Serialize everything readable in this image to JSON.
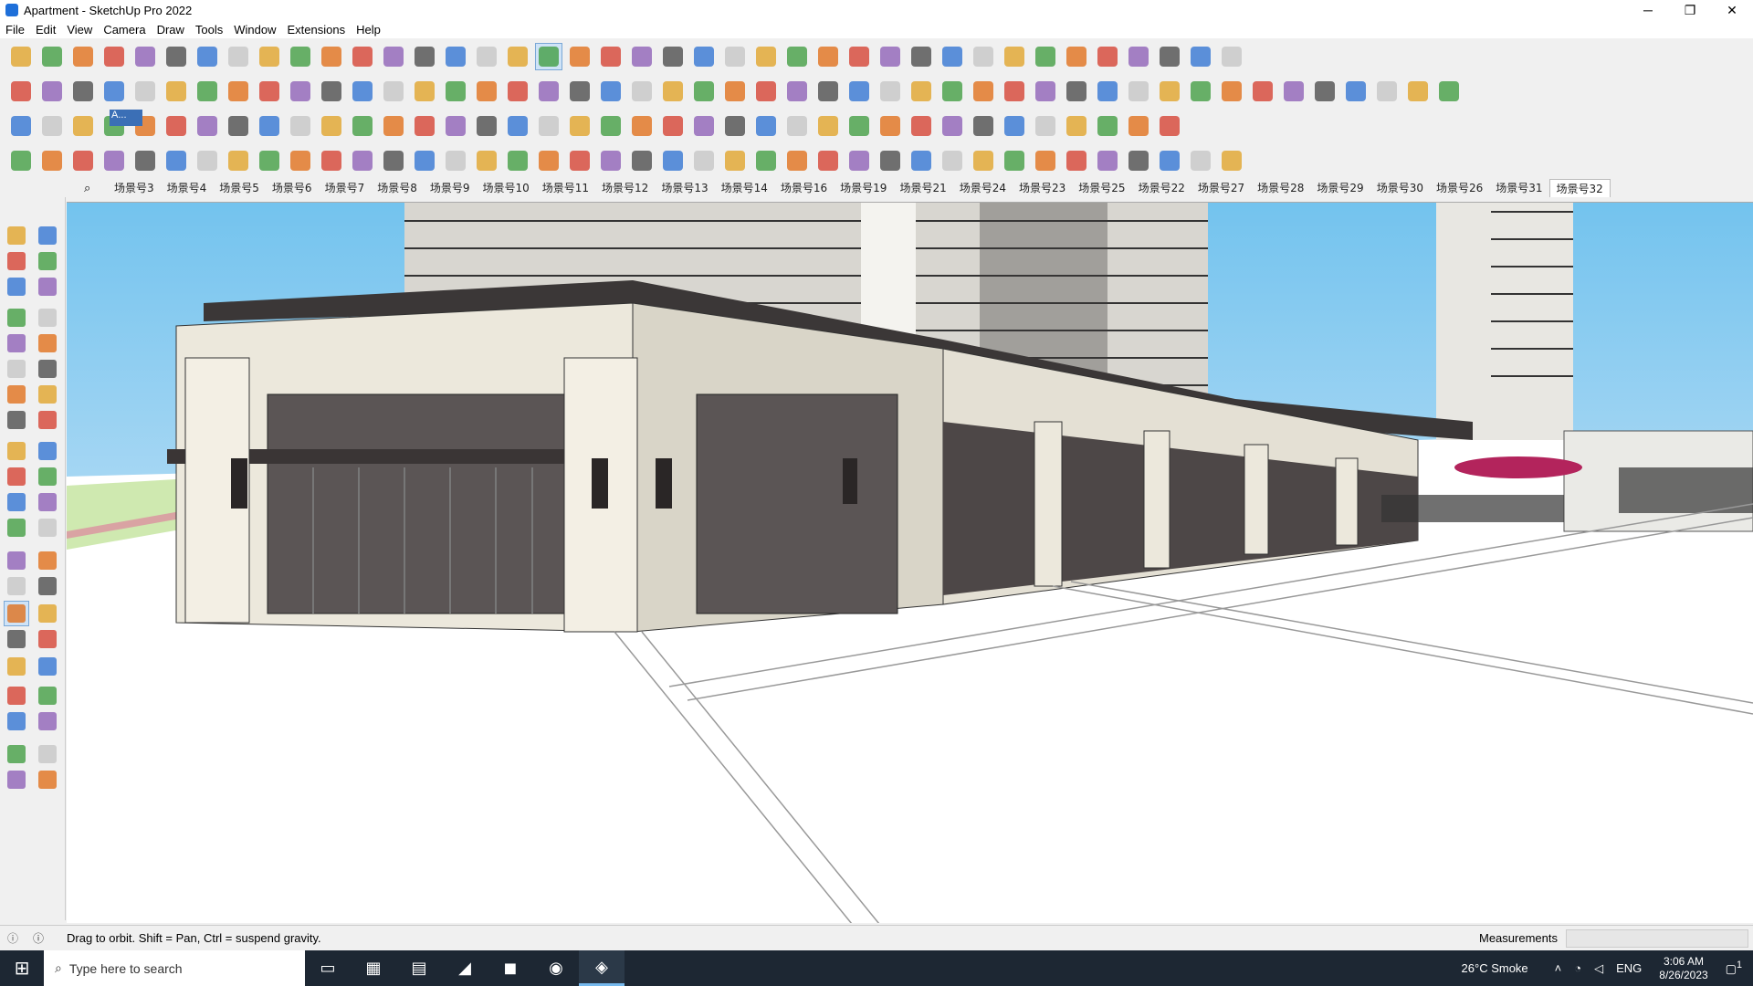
{
  "window": {
    "title": "Apartment - SketchUp Pro 2022",
    "controls": {
      "minimize": "─",
      "restore": "❐",
      "close": "✕"
    }
  },
  "menubar": {
    "items": [
      "File",
      "Edit",
      "View",
      "Camera",
      "Draw",
      "Tools",
      "Window",
      "Extensions",
      "Help"
    ]
  },
  "toolbars": {
    "tooltip_label": "A...",
    "icons": [
      "search-icon",
      "select-icon",
      "eraser-icon",
      "pencil-icon",
      "lasso-icon",
      "shape-icon",
      "pushpull-icon",
      "orbit-icon",
      "pan-icon",
      "zoom-icon",
      "zoom-extents-icon"
    ]
  },
  "scenes": {
    "search_icon": "⌕",
    "tabs": [
      "场景号3",
      "场景号4",
      "场景号5",
      "场景号6",
      "场景号7",
      "场景号8",
      "场景号9",
      "场景号10",
      "场景号11",
      "场景号12",
      "场景号13",
      "场景号14",
      "场景号16",
      "场景号19",
      "场景号21",
      "场景号24",
      "场景号23",
      "场景号25",
      "场景号22",
      "场景号27",
      "场景号28",
      "场景号29",
      "场景号30",
      "场景号26",
      "场景号31",
      "场景号32"
    ],
    "active_index": 25
  },
  "statusbar": {
    "message": "Drag to orbit. Shift = Pan, Ctrl = suspend gravity.",
    "measurements_label": "Measurements",
    "measurements_value": ""
  },
  "taskbar": {
    "search_placeholder": "Type here to search",
    "weather": "26°C  Smoke",
    "language": "ENG",
    "time": "3:06 AM",
    "date": "8/26/2023",
    "notification_count": "1"
  },
  "colors": {
    "sky_top": "#73c3ee",
    "ground": "#ffffff",
    "building_wall": "#ece8dc",
    "building_dark": "#4a4444",
    "taskbar": "#1d2733"
  }
}
